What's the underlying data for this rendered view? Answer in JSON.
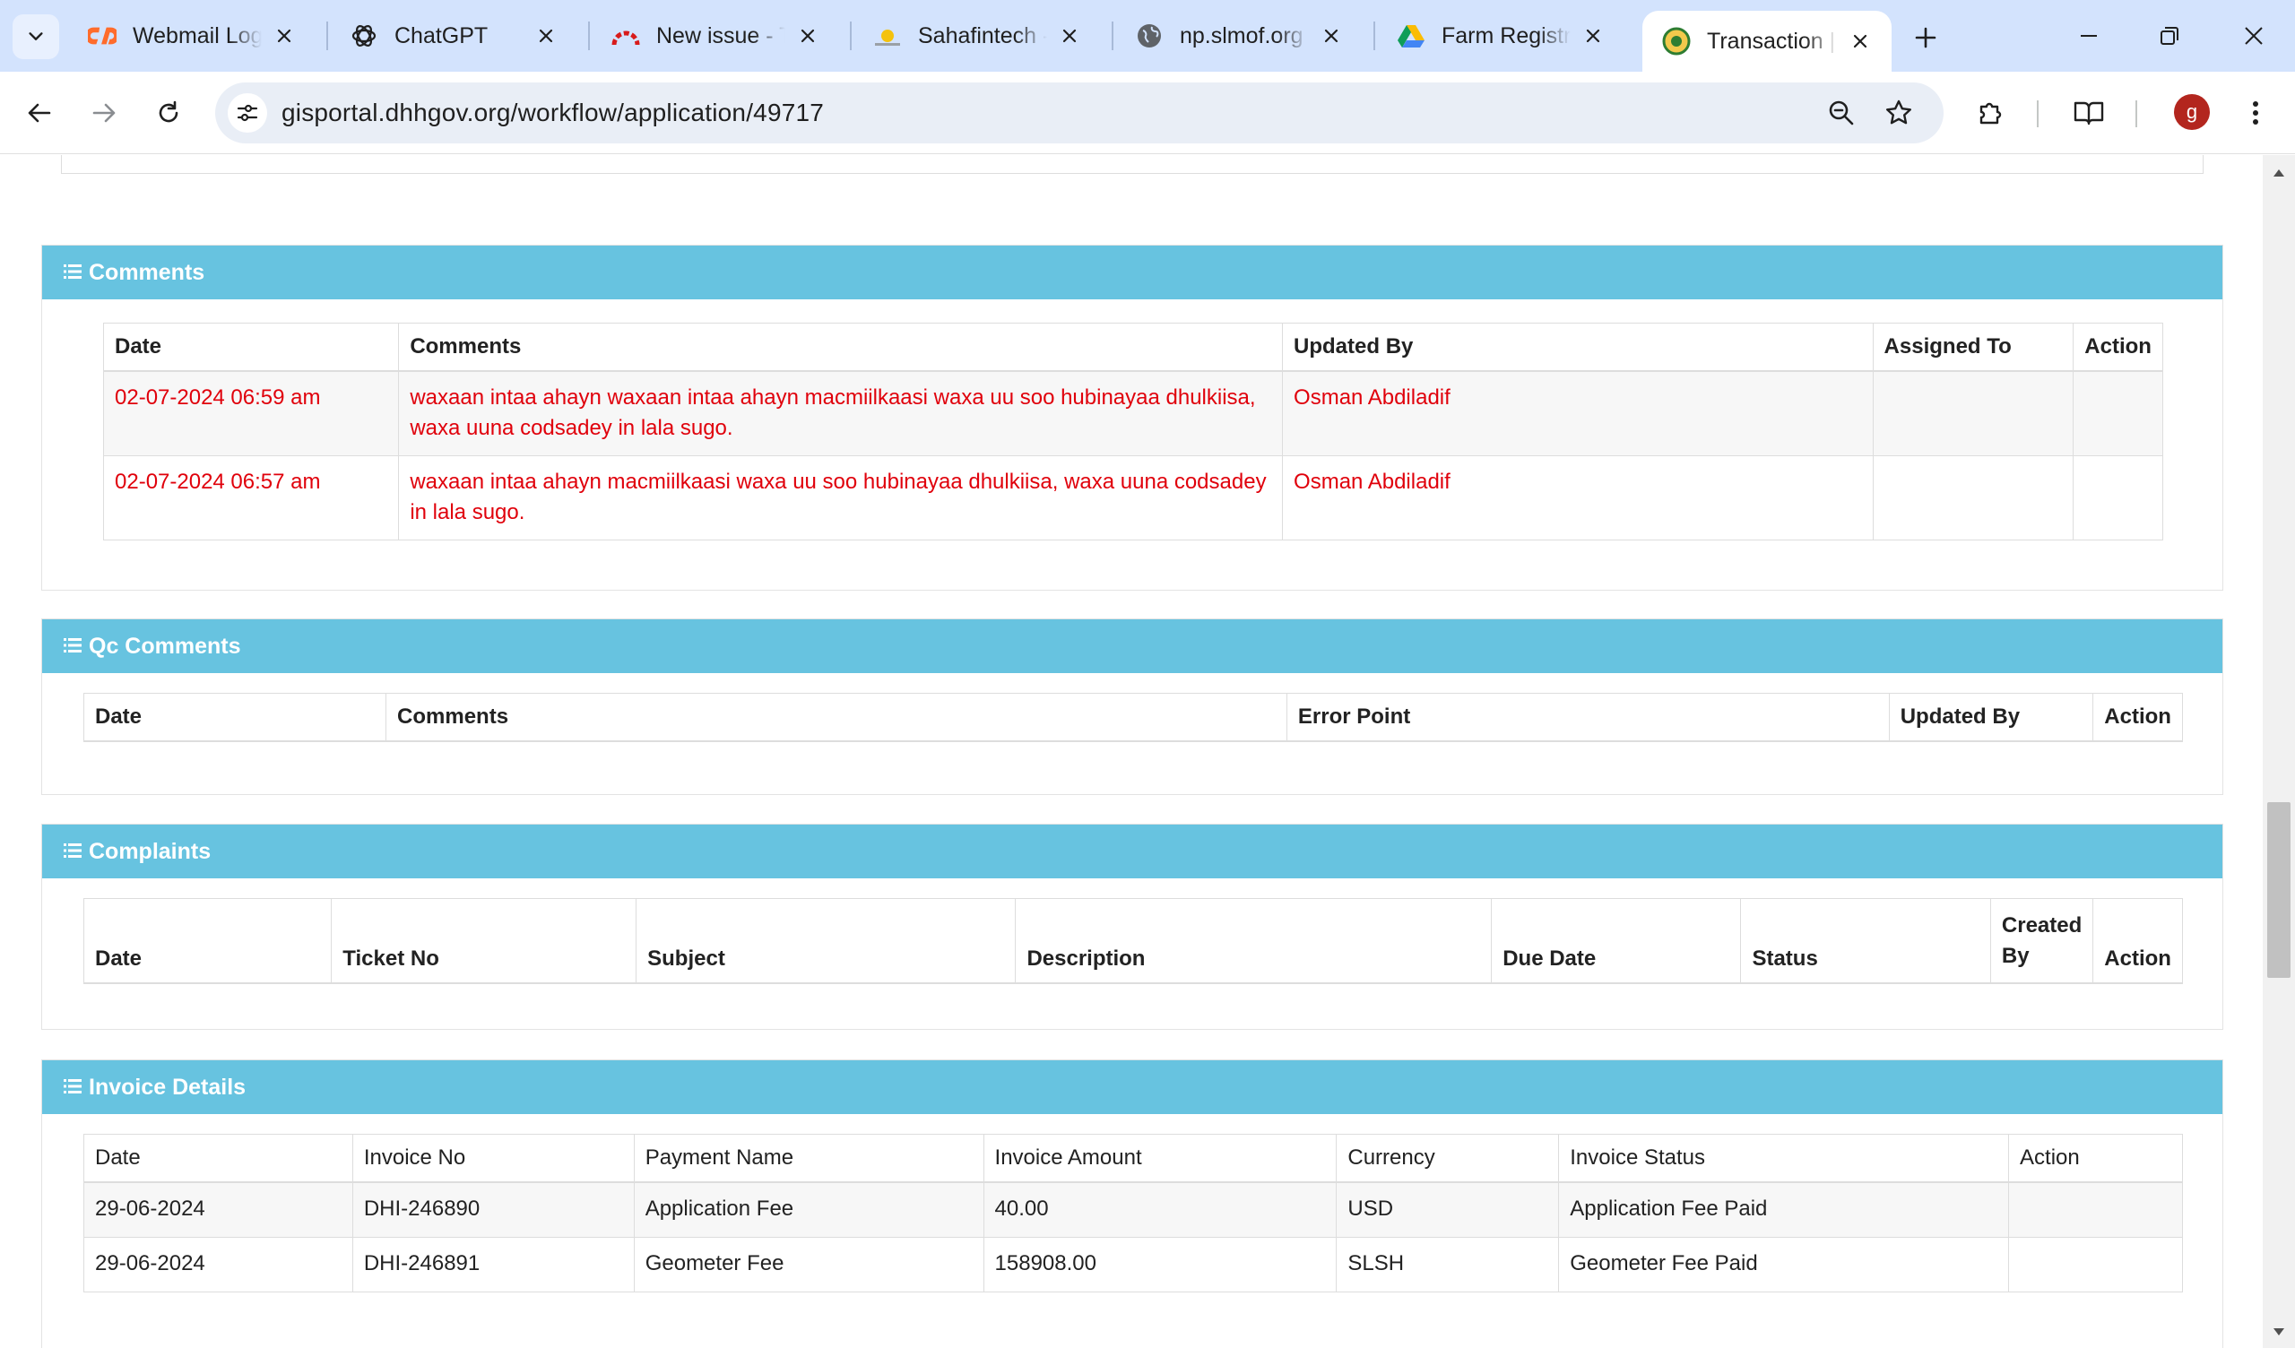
{
  "browser": {
    "tabs": [
      {
        "title": "Webmail Login",
        "favicon": "cpanel-icon"
      },
      {
        "title": "ChatGPT",
        "favicon": "openai-icon"
      },
      {
        "title": "New issue - Te",
        "favicon": "gauge-icon"
      },
      {
        "title": "Sahafintech - /",
        "favicon": "sun-icon"
      },
      {
        "title": "np.slmof.org",
        "favicon": "globe-icon"
      },
      {
        "title": "Farm Registrat",
        "favicon": "drive-icon"
      },
      {
        "title": "Transaction | G",
        "favicon": "emblem-icon",
        "active": true
      }
    ],
    "url": "gisportal.dhhgov.org/workflow/application/49717",
    "avatar_letter": "g"
  },
  "comments": {
    "title": "Comments",
    "columns": [
      "Date",
      "Comments",
      "Updated By",
      "Assigned To",
      "Action"
    ],
    "rows": [
      {
        "date": "02-07-2024 06:59 am",
        "comment": "waxaan intaa ahayn waxaan intaa ahayn macmiilkaasi waxa uu soo hubinayaa dhulkiisa, waxa uuna codsadey in lala sugo.",
        "updated_by": "Osman Abdiladif",
        "assigned_to": "",
        "action": ""
      },
      {
        "date": "02-07-2024 06:57 am",
        "comment": "waxaan intaa ahayn macmiilkaasi waxa uu soo hubinayaa dhulkiisa, waxa uuna codsadey in lala sugo.",
        "updated_by": "Osman Abdiladif",
        "assigned_to": "",
        "action": ""
      }
    ]
  },
  "qc_comments": {
    "title": "Qc Comments",
    "columns": [
      "Date",
      "Comments",
      "Error Point",
      "Updated By",
      "Action"
    ]
  },
  "complaints": {
    "title": "Complaints",
    "columns": [
      "Date",
      "Ticket No",
      "Subject",
      "Description",
      "Due Date",
      "Status",
      "Created By",
      "Action"
    ]
  },
  "invoices": {
    "title": "Invoice Details",
    "columns": [
      "Date",
      "Invoice No",
      "Payment Name",
      "Invoice Amount",
      "Currency",
      "Invoice Status",
      "Action"
    ],
    "rows": [
      {
        "date": "29-06-2024",
        "invoice_no": "DHI-246890",
        "payment_name": "Application Fee",
        "amount": "40.00",
        "currency": "USD",
        "status": "Application Fee Paid",
        "action": ""
      },
      {
        "date": "29-06-2024",
        "invoice_no": "DHI-246891",
        "payment_name": "Geometer Fee",
        "amount": "158908.00",
        "currency": "SLSH",
        "status": "Geometer Fee Paid",
        "action": ""
      }
    ]
  },
  "colors": {
    "panel_header": "#67c3e0",
    "comment_text": "#e0000b",
    "tabstrip": "#d3e3fd"
  }
}
